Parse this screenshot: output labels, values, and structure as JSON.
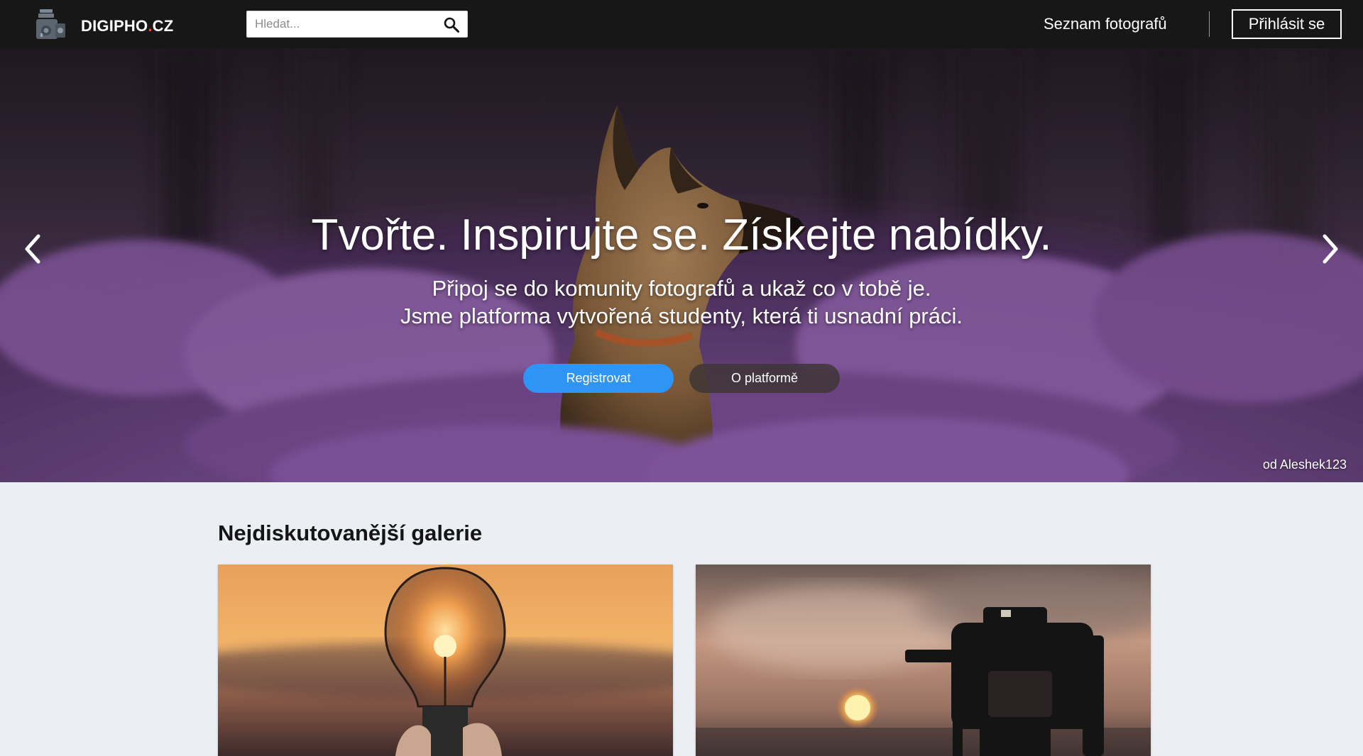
{
  "header": {
    "logo_main": "DIGIPHO",
    "logo_dot": ".",
    "logo_tld": "CZ",
    "search_placeholder": "Hledat...",
    "nav_photographers": "Seznam fotografů",
    "login": "Přihlásit se"
  },
  "hero": {
    "title": "Tvořte. Inspirujte se. Získejte nabídky.",
    "subtitle_line1": "Připoj se do komunity fotografů a ukaž co v tobě je.",
    "subtitle_line2": "Jsme platforma vytvořená studenty, která ti usnadní práci.",
    "register": "Registrovat",
    "about": "O platformě",
    "credit_prefix": "od",
    "credit_author": "Aleshek123"
  },
  "gallery": {
    "title": "Nejdiskutovanější galerie"
  },
  "colors": {
    "header_bg": "#171717",
    "primary_button": "#2f95f5",
    "logo_dot": "#e8452f",
    "page_bg": "#ebeef3"
  }
}
